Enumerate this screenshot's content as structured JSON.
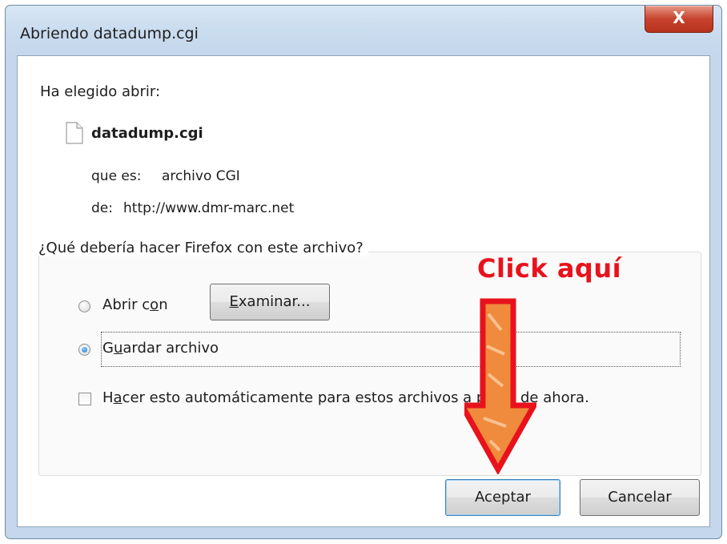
{
  "window": {
    "title": "Abriendo datadump.cgi",
    "close_glyph": "X"
  },
  "dialog": {
    "intro": "Ha elegido abrir:",
    "file_name": "datadump.cgi",
    "type_label": "que es:",
    "type_value": "archivo CGI",
    "from_label": "de:",
    "from_value": "http://www.dmr-marc.net",
    "question": "¿Qué debería hacer Firefox con este archivo?",
    "open_with": {
      "pre": "Abrir c",
      "accel": "o",
      "post": "n",
      "selected": false
    },
    "browse_button": {
      "pre": "",
      "accel": "E",
      "post": "xaminar..."
    },
    "save_file": {
      "pre": "G",
      "accel": "u",
      "post": "ardar archivo",
      "selected": true
    },
    "auto_checkbox": {
      "pre": "H",
      "accel": "a",
      "post": "cer esto automáticamente para estos archivos a partir de ahora.",
      "checked": false
    },
    "ok_button": "Aceptar",
    "cancel_button": "Cancelar"
  },
  "annotation": {
    "text": "Click aquí",
    "color": "#e8121c",
    "arrow_fill": "#f08a3c"
  },
  "icons": {
    "file": "file-icon",
    "arrow": "down-arrow-icon"
  }
}
